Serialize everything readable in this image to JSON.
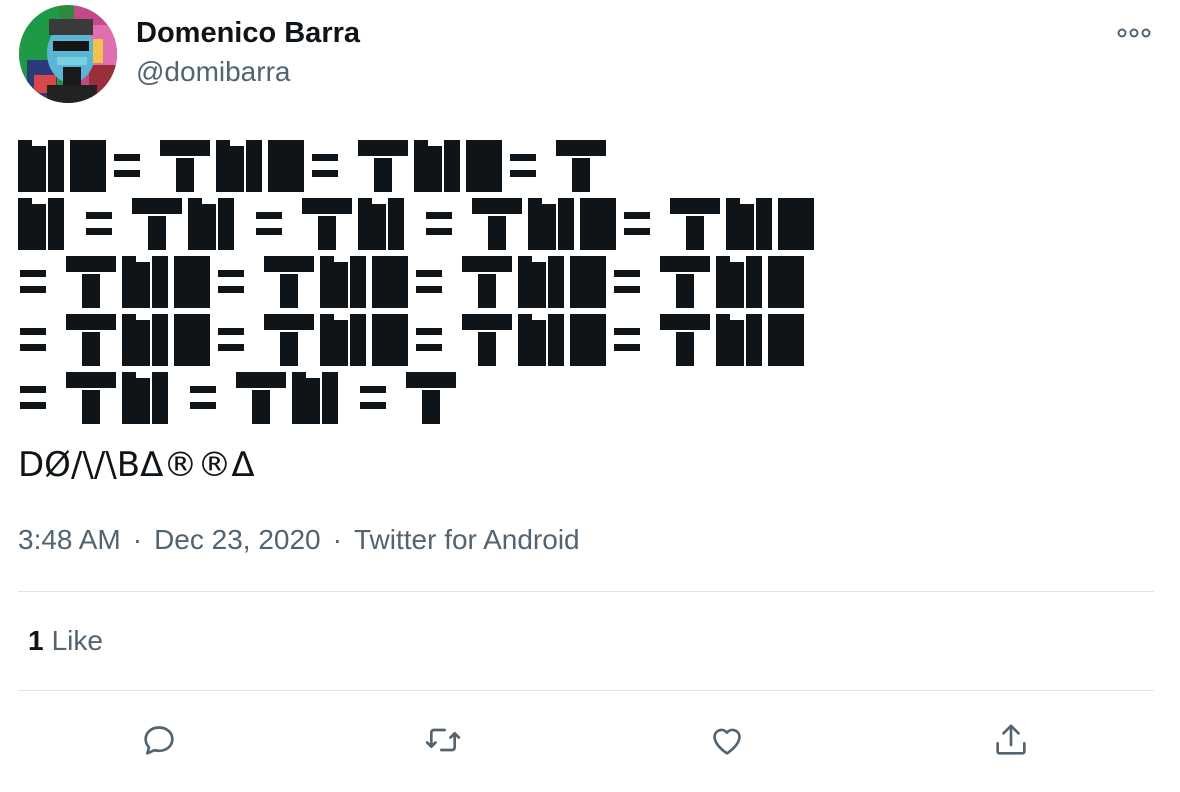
{
  "author": {
    "name": "Domenico Barra",
    "handle": "@domibarra"
  },
  "tweet": {
    "glyph_lines": [
      "N▮= TN▮= TN▮= T",
      "N = TN = TN = TN▮= TN▮",
      "= TN▮= TN▮= TN▮= TN▮",
      "= TN▮= TN▮= TN▮= TN▮",
      "= TN = TN = T"
    ],
    "signature": "DØ/\\/\\BΔ®®Δ"
  },
  "meta": {
    "time": "3:48 AM",
    "date": "Dec 23, 2020",
    "source": "Twitter for Android"
  },
  "stats": {
    "likes_count": "1",
    "likes_label": "Like"
  },
  "actions": {
    "reply_icon": "reply-icon",
    "retweet_icon": "retweet-icon",
    "like_icon": "heart-icon",
    "share_icon": "share-icon"
  },
  "colors": {
    "text": "#0f1419",
    "secondary": "#536471",
    "divider": "#e1e4e6"
  }
}
